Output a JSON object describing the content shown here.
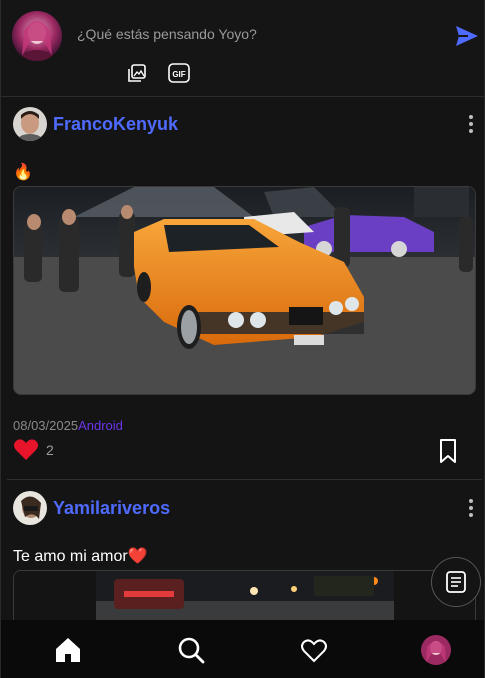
{
  "composer": {
    "placeholder": "¿Qué estás pensando Yoyo?",
    "send_icon": "send-icon",
    "tools": [
      "image-gallery-icon",
      "gif-icon"
    ],
    "gif_label": "GIF"
  },
  "posts": [
    {
      "username": "FrancoKenyuk",
      "caption": "🔥",
      "date": "08/03/2025",
      "platform": "Android",
      "likes": "2",
      "liked": true
    },
    {
      "username": "Yamilariveros",
      "caption": "Te amo mi amor❤️"
    }
  ],
  "nav": {
    "items": [
      "home-icon",
      "search-icon",
      "heart-icon",
      "profile-avatar"
    ]
  },
  "fab_icon": "feed-icon",
  "colors": {
    "accent": "#4f6bff",
    "platform": "#6a36e8",
    "like": "#e8142c",
    "background": "#141414"
  }
}
